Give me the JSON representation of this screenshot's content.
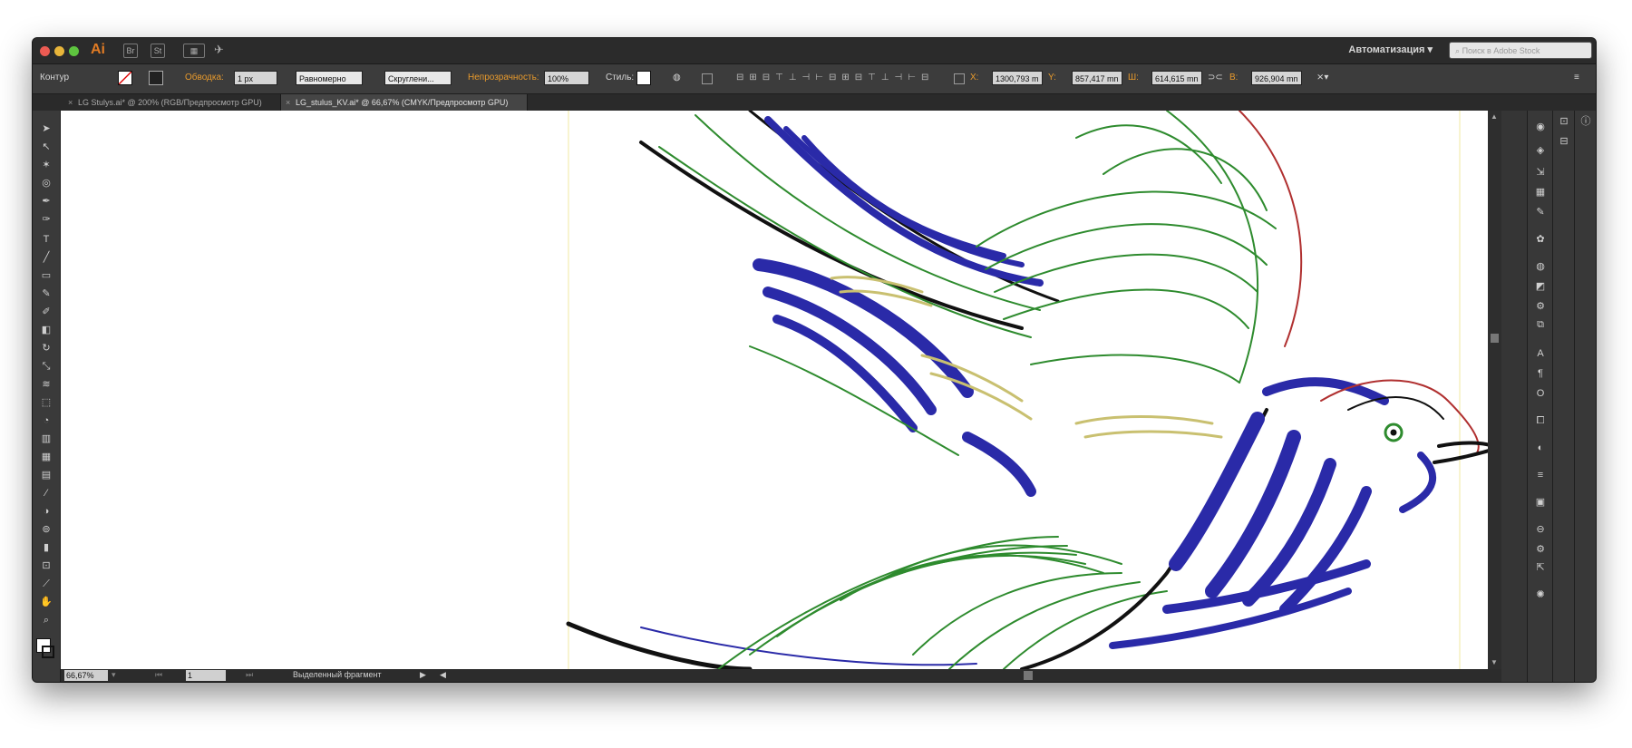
{
  "app": {
    "logo": "Ai",
    "workspace": "Автоматизация",
    "search_placeholder": "Поиск в Adobe Stock"
  },
  "control": {
    "object_type": "Контур",
    "stroke_label": "Обводка:",
    "stroke_weight": "1 px",
    "profile": "Равномерно",
    "brush": "Скруглени...",
    "opacity_label": "Непрозрачность:",
    "opacity": "100%",
    "style_label": "Стиль:",
    "x_label": "X:",
    "x": "1300,793 m",
    "y_label": "Y:",
    "y": "857,417 mn",
    "w_label": "Ш:",
    "w": "614,615 mn",
    "h_label": "В:",
    "h": "926,904 mn"
  },
  "tabs": [
    {
      "label": "LG Stulys.ai* @ 200% (RGB/Предпросмотр GPU)",
      "active": false
    },
    {
      "label": "LG_stulus_KV.ai* @ 66,67% (CMYK/Предпросмотр GPU)",
      "active": true
    }
  ],
  "status": {
    "zoom": "66,67%",
    "page": "1",
    "selection": "Выделенный фрагмент"
  },
  "colors": {
    "outline_green": "#2e8b2e",
    "outline_blue": "#2a2aa8",
    "outline_red": "#b03030",
    "outline_yellow": "#c9c070",
    "accent": "#e07b24"
  },
  "icons": {
    "tools": [
      "selection-icon",
      "direct-selection-icon",
      "magic-wand-icon",
      "lasso-icon",
      "pen-icon",
      "curvature-icon",
      "type-icon",
      "line-icon",
      "rectangle-icon",
      "paintbrush-icon",
      "blob-brush-icon",
      "eraser-icon",
      "rotate-icon",
      "scale-icon",
      "warp-icon",
      "free-transform-icon",
      "shape-builder-icon",
      "perspective-icon",
      "mesh-icon",
      "gradient-icon",
      "eyedropper-icon",
      "blend-icon",
      "symbol-sprayer-icon",
      "column-graph-icon",
      "artboard-icon",
      "slice-icon",
      "hand-icon",
      "zoom-icon"
    ],
    "panels": [
      "color-icon",
      "layers-icon",
      "export-icon",
      "libraries-icon",
      "brush-icon",
      "symbols-icon",
      "swatches-icon",
      "graphic-styles-icon",
      "appearance-icon",
      "pathfinder-icon",
      "character-icon",
      "paragraph-icon",
      "opentype-icon",
      "transform-icon",
      "transparency-icon",
      "align-icon",
      "gradient-panel-icon",
      "links-icon",
      "asset-export-icon",
      "navigator-icon",
      "stroke-icon"
    ]
  }
}
